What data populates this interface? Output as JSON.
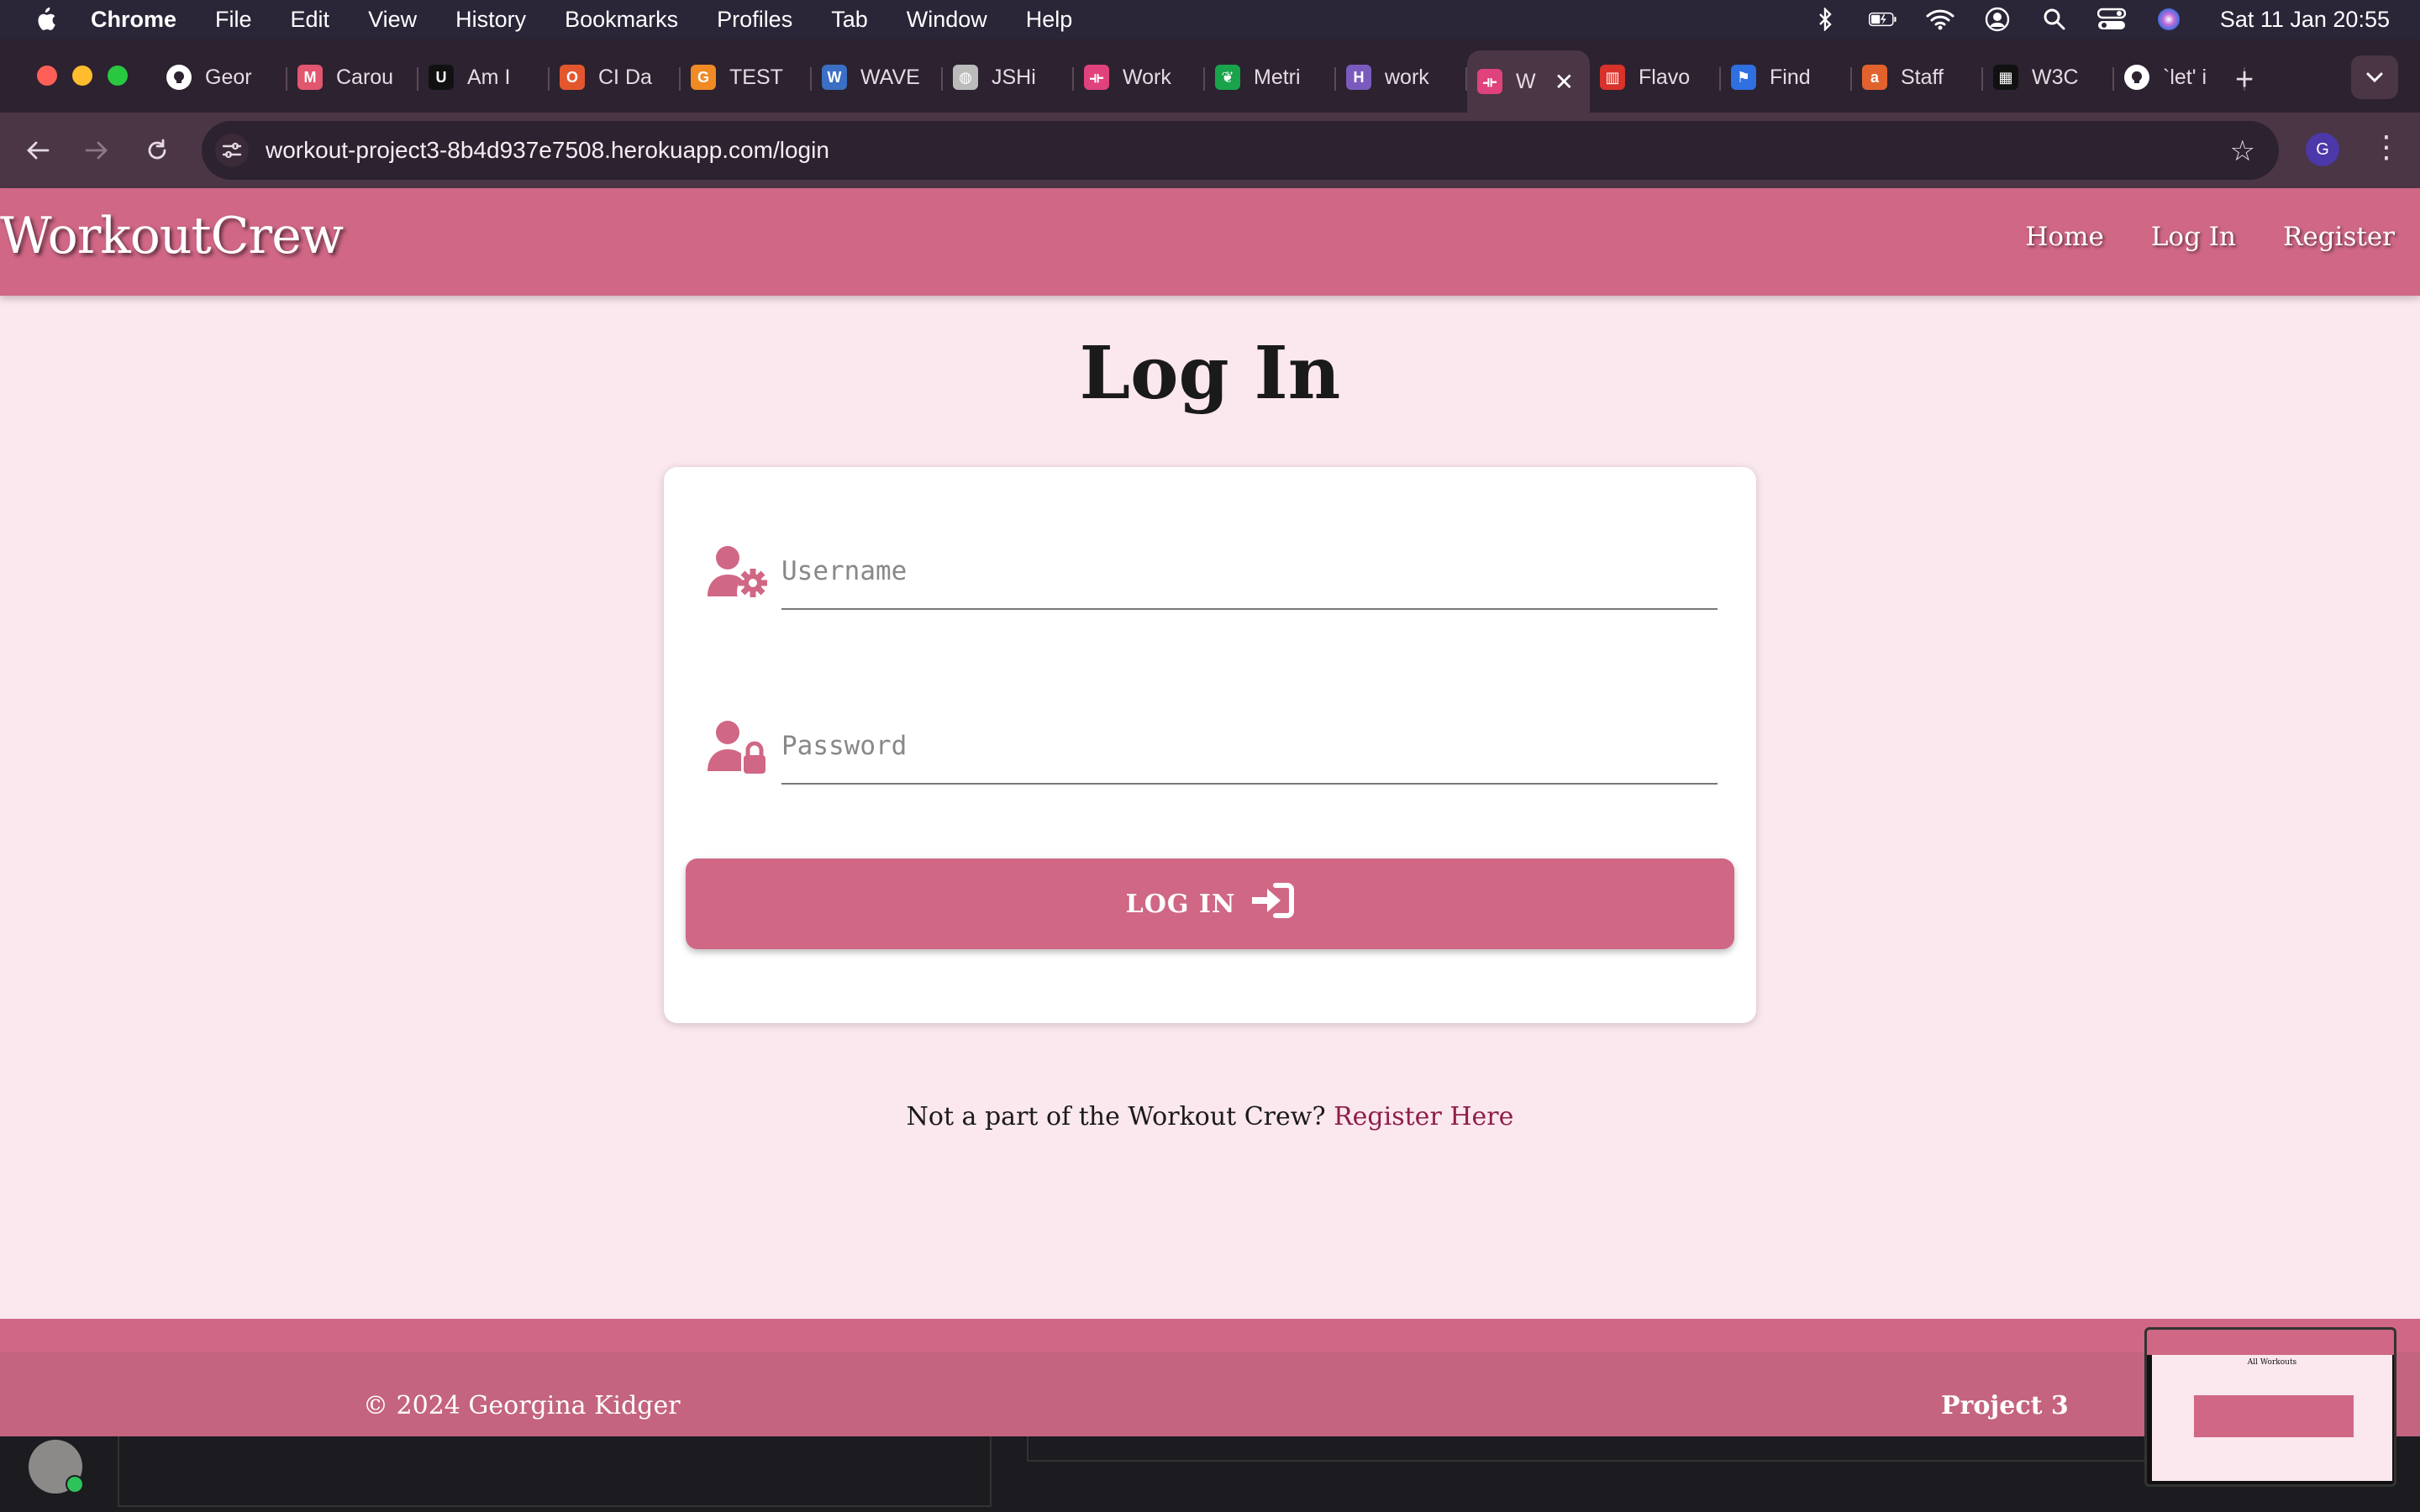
{
  "menubar": {
    "app": "Chrome",
    "items": [
      "File",
      "Edit",
      "View",
      "History",
      "Bookmarks",
      "Profiles",
      "Tab",
      "Window",
      "Help"
    ],
    "clock": "Sat 11 Jan  20:55"
  },
  "tabs": [
    {
      "title": "Geor",
      "icon": "github-icon",
      "color": "#ffffff"
    },
    {
      "title": "Carou",
      "icon": "carousel-icon",
      "color": "#e2566f"
    },
    {
      "title": "Am I",
      "icon": "ui-icon",
      "color": "#111111"
    },
    {
      "title": "CI Da",
      "icon": "ci-icon",
      "color": "#e4572e"
    },
    {
      "title": "TEST",
      "icon": "test-icon",
      "color": "#f08a24"
    },
    {
      "title": "WAVE",
      "icon": "wave-icon",
      "color": "#3a6fc4"
    },
    {
      "title": "JSHi",
      "icon": "globe-icon",
      "color": "#bbbbbb"
    },
    {
      "title": "Work",
      "icon": "dumbbell-icon",
      "color": "#e0427c"
    },
    {
      "title": "Metri",
      "icon": "leaf-icon",
      "color": "#19a34a"
    },
    {
      "title": "work",
      "icon": "heroku-icon",
      "color": "#7a5bbd"
    },
    {
      "title": "W",
      "icon": "dumbbell-icon",
      "color": "#e0427c",
      "active": true
    },
    {
      "title": "Flavo",
      "icon": "fries-icon",
      "color": "#d8322a"
    },
    {
      "title": "Find",
      "icon": "flag-icon",
      "color": "#2f6fe0"
    },
    {
      "title": "Staff",
      "icon": "staff-icon",
      "color": "#e2622d"
    },
    {
      "title": "W3C",
      "icon": "w3c-icon",
      "color": "#111111"
    },
    {
      "title": "`let' i",
      "icon": "github-icon",
      "color": "#ffffff"
    }
  ],
  "browser": {
    "url": "workout-project3-8b4d937e7508.herokuapp.com/login",
    "profile_initial": "G"
  },
  "site": {
    "brand": "WorkoutCrew",
    "nav": [
      "Home",
      "Log In",
      "Register"
    ],
    "page_title": "Log In",
    "username_placeholder": "Username",
    "password_placeholder": "Password",
    "login_button": "LOG IN",
    "register_prompt": "Not a part of the Workout Crew?",
    "register_link": "Register Here",
    "footer_copyright": "© 2024 Georgina Kidger",
    "footer_project": "Project 3"
  },
  "thumbnail": {
    "title": "All Workouts"
  },
  "colors": {
    "brand_pink": "#cf6785",
    "page_bg": "#fbe7ee",
    "link": "#8e1d4a"
  }
}
